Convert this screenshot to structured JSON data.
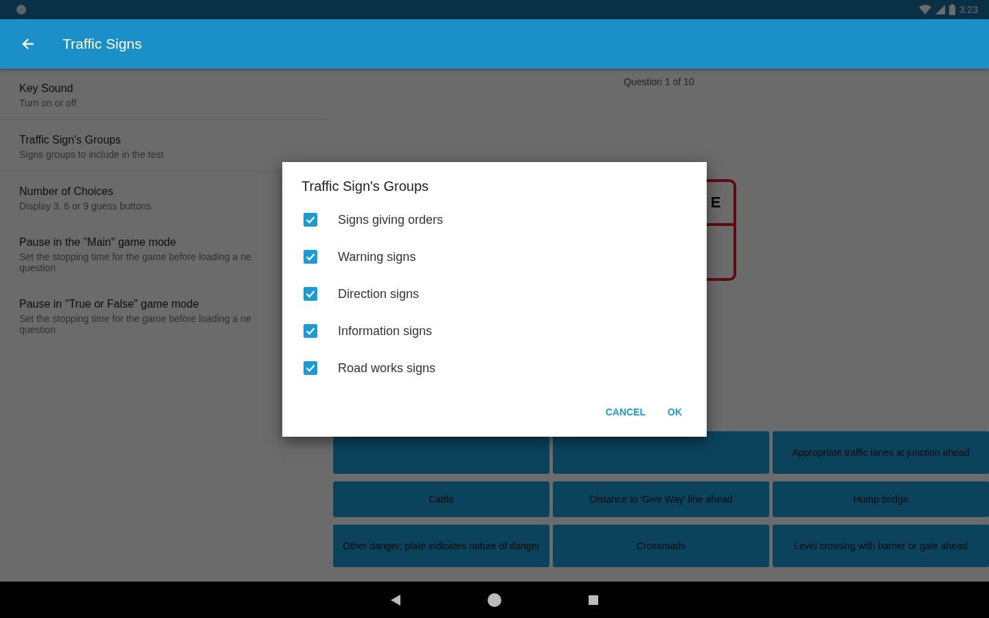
{
  "status_bar": {
    "time": "3:23"
  },
  "app_bar": {
    "title": "Traffic Signs"
  },
  "settings": [
    {
      "title": "Key Sound",
      "subtitle": [
        "Turn on or off"
      ],
      "divider": true
    },
    {
      "title": "Traffic Sign's Groups",
      "subtitle": [
        "Signs groups to include in the test"
      ],
      "divider": true
    },
    {
      "title": "Number of Choices",
      "subtitle": [
        "Display 3, 6 or 9 guess buttons"
      ],
      "divider": false
    },
    {
      "title": "Pause in the \"Main\" game mode",
      "subtitle": [
        "Set the stopping time for the game before loading a ne",
        "question"
      ],
      "divider": false
    },
    {
      "title": "Pause in \"True or False\" game mode",
      "subtitle": [
        "Set the stopping time for the game before loading a ne",
        "question"
      ],
      "divider": false
    }
  ],
  "quiz": {
    "progress": "Question 1 of 10",
    "sign_text": "E",
    "answers": [
      {
        "kind": "covered"
      },
      {
        "kind": "covered"
      },
      {
        "label": "Appropriate traffic lanes at junction ahead"
      },
      {
        "label": "Cattle"
      },
      {
        "label": "Distance to 'Give Way' line ahead"
      },
      {
        "label": "Hump bridge"
      },
      {
        "label": "Other danger; plate indicates nature of danger"
      },
      {
        "label": "Crossroads"
      },
      {
        "label": "Level crossing with barrier or gate ahead"
      }
    ]
  },
  "dialog": {
    "title": "Traffic Sign's Groups",
    "options": [
      {
        "label": "Signs giving orders",
        "checked": true
      },
      {
        "label": "Warning signs",
        "checked": true
      },
      {
        "label": "Direction signs",
        "checked": true
      },
      {
        "label": "Information signs",
        "checked": true
      },
      {
        "label": "Road works signs",
        "checked": true
      }
    ],
    "buttons": [
      "CANCEL",
      "OK"
    ]
  }
}
